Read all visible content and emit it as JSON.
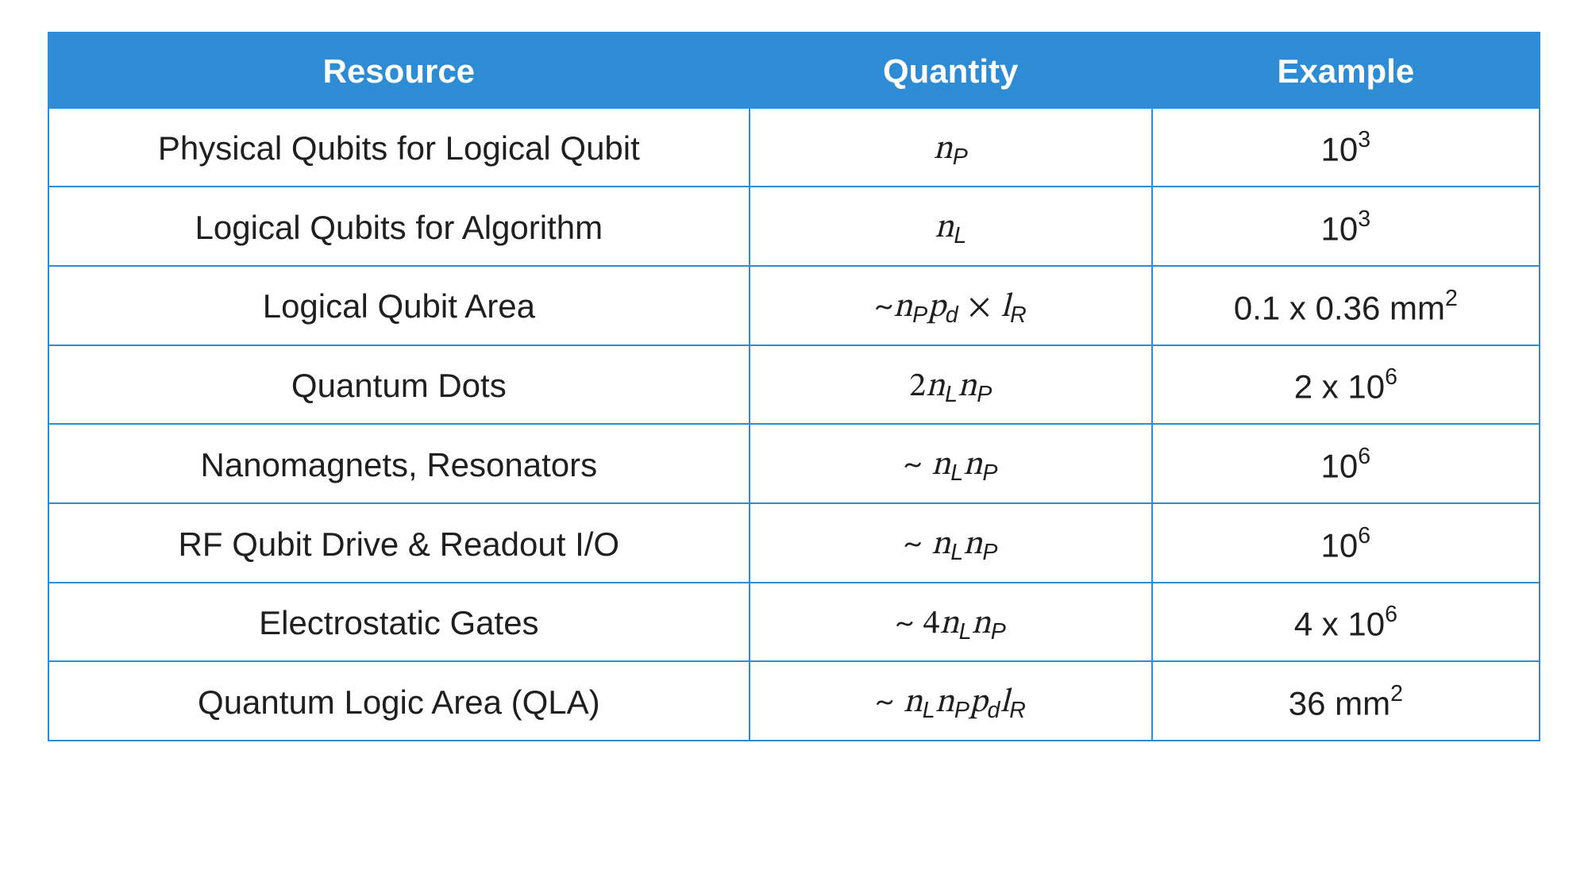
{
  "columns": [
    "Resource",
    "Quantity",
    "Example"
  ],
  "rows": [
    {
      "resource": "Physical Qubits for Logical Qubit",
      "quantity_html": "<span class='mi'>n</span><span class='sub'>P</span>",
      "example_html": "<span class='example'>10</span><span class='sup'>3</span>"
    },
    {
      "resource": "Logical Qubits for Algorithm",
      "quantity_html": "<span class='mi'>n</span><span class='sub'>L</span>",
      "example_html": "<span class='example'>10</span><span class='sup'>3</span>"
    },
    {
      "resource": "Logical Qubit Area",
      "quantity_html": "<span class='mn'>~</span><span class='mi'>n</span><span class='sub'>P</span><span class='mi'>p</span><span class='sub'>d</span> <span class='mn'>×</span> <span class='mi'>l</span><span class='sub'>R</span>",
      "example_html": "<span class='example'>0.1 x 0.36 mm</span><span class='sup'>2</span>"
    },
    {
      "resource": "Quantum Dots",
      "quantity_html": "<span class='mn'>2</span><span class='mi'>n</span><span class='sub'>L</span><span class='mi'>n</span><span class='sub'>P</span>",
      "example_html": "<span class='example'>2 x 10</span><span class='sup'>6</span>"
    },
    {
      "resource": "Nanomagnets, Resonators",
      "quantity_html": "<span class='mn'>~</span> <span class='mi'>n</span><span class='sub'>L</span><span class='mi'>n</span><span class='sub'>P</span>",
      "example_html": "<span class='example'>10</span><span class='sup'>6</span>"
    },
    {
      "resource": "RF Qubit Drive & Readout I/O",
      "quantity_html": "<span class='mn'>~</span> <span class='mi'>n</span><span class='sub'>L</span><span class='mi'>n</span><span class='sub'>P</span>",
      "example_html": "<span class='example'>10</span><span class='sup'>6</span>"
    },
    {
      "resource": "Electrostatic Gates",
      "quantity_html": "<span class='mn'>~</span> <span class='mn'>4</span><span class='mi'>n</span><span class='sub'>L</span><span class='mi'>n</span><span class='sub'>P</span>",
      "example_html": "<span class='example'>4 x 10</span><span class='sup'>6</span>"
    },
    {
      "resource": "Quantum Logic Area (QLA)",
      "quantity_html": "<span class='mn'>~</span> <span class='mi'>n</span><span class='sub'>L</span><span class='mi'>n</span><span class='sub'>P</span><span class='mi'>p</span><span class='sub'>d</span><span class='mi'>l</span><span class='sub'>R</span>",
      "example_html": "<span class='example'>36 mm</span><span class='sup'>2</span>"
    }
  ]
}
